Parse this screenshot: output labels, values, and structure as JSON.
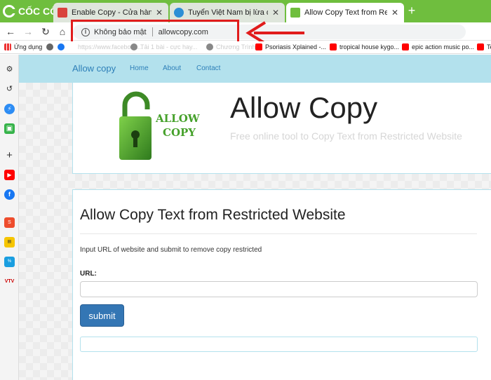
{
  "browser": {
    "logo_text": "CỐC CỐC",
    "tabs": [
      {
        "title": "Enable Copy - Cửa hàng Chrom",
        "favicon_color": "#d9433c"
      },
      {
        "title": "Tuyển Việt Nam bị lừa đàn em",
        "favicon_color": "#2d8fd5"
      },
      {
        "title": "Allow Copy Text from Restricte",
        "favicon_color": "#6fbe3e"
      }
    ],
    "new_tab": "+",
    "address": {
      "security": "Không bảo mật",
      "url": "allowcopy.com"
    },
    "bookmarks": [
      {
        "label": "Ứng dụng",
        "icon_color": "#e33"
      },
      {
        "label": "",
        "icon_color": "#666"
      },
      {
        "label": "",
        "icon_color": "#1877f2"
      },
      {
        "label": "https://www.facebook...",
        "icon_color": "#1877f2"
      },
      {
        "label": "Tải 1 bài - cực hay...",
        "icon_color": "#888"
      },
      {
        "label": "Chương Trình",
        "icon_color": "#f00"
      },
      {
        "label": "Psoriasis Xplained -...",
        "icon_color": "#f00"
      },
      {
        "label": "tropical house kygo...",
        "icon_color": "#f00"
      },
      {
        "label": "epic action music po...",
        "icon_color": "#f00"
      },
      {
        "label": "Te",
        "icon_color": "#f00"
      }
    ]
  },
  "site": {
    "brand": "Allow copy",
    "nav": [
      "Home",
      "About",
      "Contact"
    ],
    "logo_text_1": "ALLOW",
    "logo_text_2": "COPY",
    "hero_title": "Allow Copy",
    "hero_subtitle": "Free online tool to Copy Text from Restricted Website",
    "card_title": "Allow Copy Text from Restricted Website",
    "description": "Input URL of website and submit to remove copy restricted",
    "url_label": "URL:",
    "url_value": "",
    "submit_label": "submit",
    "accent": "#3476b4",
    "nav_bg": "#b3e1ed"
  },
  "annotation": {
    "highlight_color": "#e11c1c"
  }
}
